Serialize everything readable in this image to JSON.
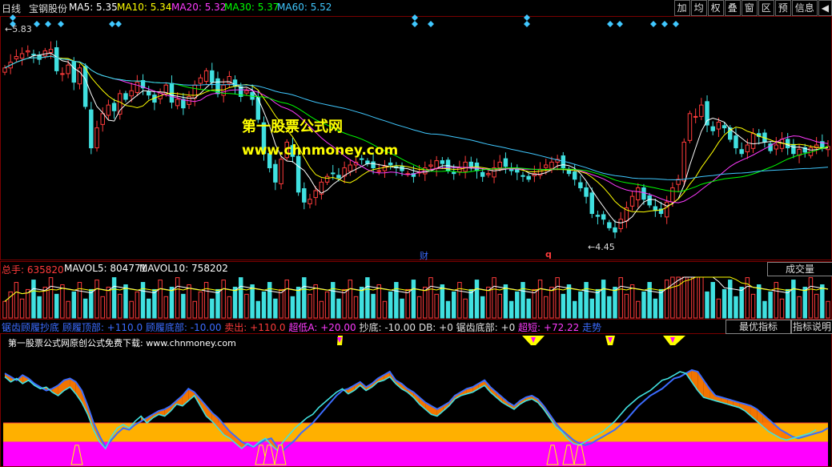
{
  "top": {
    "period": "日线",
    "stock": "宝钢股份",
    "ma5": "MA5: 5.35",
    "ma10": "MA10: 5.34",
    "ma20": "MA20: 5.32",
    "ma30": "MA30: 5.37",
    "ma60": "MA60: 5.52",
    "buttons": [
      "加",
      "均",
      "权",
      "叠",
      "窗",
      "区",
      "预",
      "信息"
    ]
  },
  "price": {
    "high_label": "5.83",
    "low_label": "4.45",
    "event_cai": "财",
    "event_q": "q",
    "watermark_cn": "第一股票公式网",
    "watermark_url": "www.chnmoney.com"
  },
  "volume": {
    "total": "总手: 635820",
    "mavol5": "MAVOL5: 804771",
    "mavol10": "MAVOL10: 758202",
    "button": "成交量"
  },
  "indicator": {
    "legend": [
      {
        "text": "锯齿顾履抄底",
        "color": "#3b6cff"
      },
      {
        "text": "顾履顶部: +110.0",
        "color": "#3b6cff"
      },
      {
        "text": "顾履底部: -10.00",
        "color": "#3b6cff"
      },
      {
        "text": "卖出: +110.0",
        "color": "#ff3b3b"
      },
      {
        "text": "超低A: +20.00",
        "color": "#ff3bff"
      },
      {
        "text": "抄底: -10.00",
        "color": "#e0e0e0"
      },
      {
        "text": "DB: +0",
        "color": "#e0e0e0"
      },
      {
        "text": "锯齿底部: +0",
        "color": "#e0e0e0"
      },
      {
        "text": "超短: +72.22",
        "color": "#ff3bff"
      },
      {
        "text": "走势",
        "color": "#3b6cff"
      }
    ],
    "btn_best": "最优指标",
    "btn_help": "指标说明",
    "banner": "第一股票公式网原创公式免费下载: www.chnmoney.com"
  },
  "colors": {
    "up": "#ff3b3b",
    "down": "#40e0e0",
    "ma5": "#ffffff",
    "ma10": "#ffff00",
    "ma20": "#ff3bff",
    "ma30": "#00ff00",
    "ma60": "#40c8ff",
    "zone_orange": "#ffb000",
    "zone_magenta": "#ff00ff"
  },
  "chart_data": [
    {
      "type": "candlestick",
      "ylim": [
        4.3,
        5.95
      ],
      "closes": [
        5.62,
        5.66,
        5.7,
        5.72,
        5.74,
        5.71,
        5.68,
        5.74,
        5.75,
        5.6,
        5.58,
        5.64,
        5.52,
        5.62,
        5.35,
        5.06,
        5.2,
        5.3,
        5.36,
        5.32,
        5.44,
        5.4,
        5.46,
        5.52,
        5.48,
        5.43,
        5.38,
        5.45,
        5.5,
        5.38,
        5.4,
        5.34,
        5.42,
        5.5,
        5.55,
        5.6,
        5.52,
        5.44,
        5.5,
        5.56,
        5.49,
        5.42,
        5.46,
        5.4,
        5.26,
        5.02,
        4.92,
        4.82,
        4.98,
        5.1,
        5.0,
        4.75,
        4.68,
        4.7,
        4.76,
        4.82,
        4.86,
        4.88,
        4.85,
        4.92,
        4.94,
        4.96,
        4.98,
        4.95,
        4.92,
        4.9,
        4.93,
        4.94,
        4.92,
        4.9,
        4.88,
        4.86,
        4.89,
        4.92,
        4.94,
        4.97,
        4.95,
        4.9,
        4.88,
        4.92,
        4.96,
        4.93,
        4.9,
        4.86,
        4.88,
        4.92,
        4.96,
        4.93,
        4.9,
        4.89,
        4.86,
        4.84,
        4.88,
        4.91,
        4.94,
        4.96,
        4.98,
        4.92,
        4.88,
        4.84,
        4.78,
        4.72,
        4.6,
        4.58,
        4.56,
        4.5,
        4.47,
        4.56,
        4.64,
        4.72,
        4.78,
        4.7,
        4.66,
        4.62,
        4.6,
        4.68,
        4.78,
        4.84,
        5.1,
        5.3,
        5.28,
        5.36,
        5.22,
        5.18,
        5.24,
        5.2,
        5.12,
        5.06,
        5.02,
        5.08,
        5.16,
        5.14,
        5.1,
        5.04,
        5.08,
        5.12,
        5.06,
        5.02,
        5.05,
        5.03,
        5.06,
        5.08,
        5.06,
        5.07
      ],
      "ma5_last": 5.35,
      "ma10_last": 5.34,
      "ma20_last": 5.32,
      "ma30_last": 5.37,
      "ma60_last": 5.52,
      "high": 5.83,
      "low": 4.45
    },
    {
      "type": "bar",
      "ylim": [
        0,
        1600000
      ],
      "total": 635820,
      "mavol5": 804771,
      "mavol10": 758202
    },
    {
      "type": "line",
      "ylim": [
        -10,
        110
      ],
      "series": [
        {
          "name": "锯齿顾履抄底",
          "values": [
            78,
            74,
            70,
            76,
            72,
            66,
            62,
            58,
            60,
            64,
            70,
            72,
            68,
            58,
            40,
            20,
            5,
            -8,
            0,
            8,
            14,
            12,
            18,
            22,
            26,
            30,
            34,
            36,
            40,
            46,
            52,
            60,
            56,
            48,
            40,
            32,
            26,
            18,
            10,
            4,
            -2,
            -6,
            -8,
            -4,
            0,
            2,
            -8,
            -12,
            -6,
            0,
            8,
            14,
            20,
            28,
            36,
            44,
            52,
            58,
            60,
            64,
            68,
            62,
            66,
            72,
            76,
            80,
            70,
            66,
            60,
            56,
            50,
            44,
            40,
            36,
            40,
            44,
            52,
            56,
            60,
            62,
            66,
            70,
            62,
            56,
            50,
            44,
            40,
            46,
            50,
            52,
            48,
            40,
            30,
            20,
            12,
            6,
            0,
            -4,
            -6,
            -4,
            0,
            4,
            8,
            12,
            18,
            24,
            32,
            40,
            46,
            52,
            56,
            60,
            66,
            72,
            74,
            78,
            82,
            80,
            70,
            60,
            52,
            50,
            48,
            46,
            44,
            42,
            40,
            36,
            30,
            24,
            18,
            12,
            8,
            4,
            2,
            4,
            6,
            8,
            10,
            14
          ],
          "color": "#3b6cff"
        },
        {
          "name": "走势",
          "values": [
            74,
            68,
            72,
            66,
            70,
            64,
            60,
            62,
            56,
            52,
            58,
            62,
            54,
            44,
            30,
            12,
            -2,
            -10,
            4,
            14,
            18,
            14,
            22,
            28,
            20,
            26,
            30,
            28,
            34,
            42,
            40,
            46,
            52,
            40,
            28,
            22,
            14,
            6,
            2,
            -4,
            -10,
            -4,
            -8,
            -2,
            2,
            -6,
            -12,
            -2,
            6,
            14,
            20,
            26,
            30,
            38,
            44,
            50,
            56,
            60,
            54,
            58,
            64,
            58,
            62,
            68,
            70,
            74,
            66,
            60,
            56,
            50,
            42,
            36,
            30,
            28,
            34,
            40,
            48,
            52,
            54,
            56,
            60,
            64,
            56,
            50,
            44,
            40,
            36,
            42,
            46,
            48,
            44,
            36,
            26,
            16,
            10,
            2,
            -4,
            -6,
            -2,
            2,
            6,
            10,
            16,
            22,
            30,
            38,
            44,
            50,
            54,
            58,
            64,
            70,
            72,
            76,
            80,
            78,
            68,
            58,
            50,
            48,
            46,
            44,
            42,
            40,
            38,
            34,
            28,
            22,
            16,
            10,
            6,
            2,
            0,
            2,
            4,
            6,
            8,
            12
          ],
          "color": "#40e0e0"
        }
      ]
    }
  ]
}
